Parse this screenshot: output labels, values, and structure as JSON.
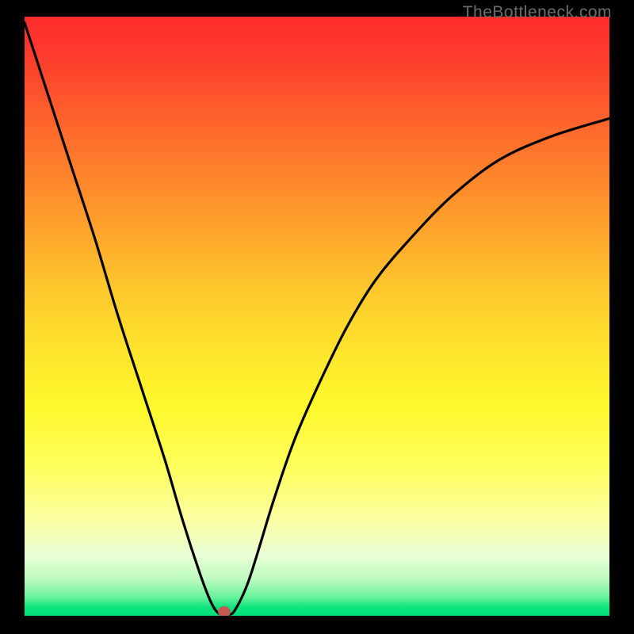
{
  "watermark": "TheBottleneck.com",
  "colors": {
    "frame_bg": "#000000",
    "curve": "#000000",
    "dot": "#c45a52",
    "watermark": "#6c6c6c"
  },
  "chart_data": {
    "type": "line",
    "title": "",
    "xlabel": "",
    "ylabel": "",
    "xlim": [
      0,
      100
    ],
    "ylim": [
      0,
      100
    ],
    "grid": false,
    "legend": false,
    "annotations": [],
    "series": [
      {
        "name": "bottleneck-curve",
        "x": [
          0,
          4,
          8,
          12,
          16,
          20,
          24,
          27,
          30,
          32,
          33.5,
          35,
          36,
          38,
          40,
          42.5,
          46,
          50,
          55,
          60,
          66,
          73,
          81,
          90,
          100
        ],
        "y": [
          99,
          87,
          75,
          63,
          50,
          38,
          26,
          16,
          7,
          2,
          0.2,
          0.2,
          1,
          5,
          11,
          19,
          29,
          38,
          48,
          56,
          63,
          70,
          76,
          80,
          83
        ]
      }
    ],
    "marker": {
      "x_frac": 0.342,
      "y_frac": 0.994,
      "color": "#c45a52"
    }
  }
}
